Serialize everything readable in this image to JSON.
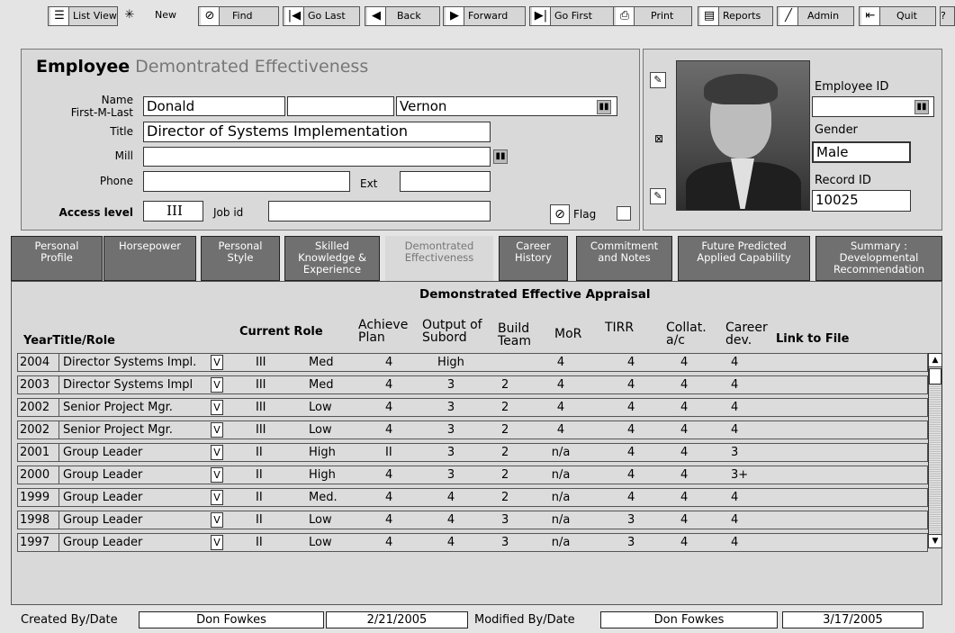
{
  "toolbar": {
    "items": [
      {
        "label": "List View",
        "icon": "list-icon"
      },
      {
        "label": "New",
        "icon": "new-icon"
      },
      {
        "label": "Find",
        "icon": "find-icon"
      },
      {
        "label": "Go Last",
        "icon": "go-last-icon"
      },
      {
        "label": "Back",
        "icon": "back-icon"
      },
      {
        "label": "Forward",
        "icon": "forward-icon"
      },
      {
        "label": "Go First",
        "icon": "go-first-icon"
      },
      {
        "label": "Print",
        "icon": "print-icon"
      },
      {
        "label": "Reports",
        "icon": "reports-icon"
      },
      {
        "label": "Admin",
        "icon": "admin-icon"
      },
      {
        "label": "Quit",
        "icon": "quit-icon"
      }
    ]
  },
  "header": {
    "title_bold": "Employee",
    "title_light": "Demontrated Effectiveness"
  },
  "form": {
    "name_label": "Name\nFirst-M-Last",
    "first_name": "Donald",
    "middle_name": "",
    "last_name": "Vernon",
    "title_label": "Title",
    "title_value": "Director of Systems Implementation",
    "mill_label": "Mill",
    "mill_value": "",
    "phone_label": "Phone",
    "phone_value": "",
    "ext_label": "Ext",
    "ext_value": "",
    "access_label": "Access level",
    "access_value": "III",
    "jobid_label": "Job id",
    "jobid_value": "",
    "flag_label": "Flag"
  },
  "side": {
    "employee_id_label": "Employee ID",
    "employee_id_value": "",
    "gender_label": "Gender",
    "gender_value": "Male",
    "record_id_label": "Record ID",
    "record_id_value": "10025"
  },
  "tabs": [
    {
      "label": "Personal\nProfile",
      "active": false
    },
    {
      "label": "Horsepower",
      "active": false
    },
    {
      "label": "Personal\nStyle",
      "active": false
    },
    {
      "label": "Skilled\nKnowledge &\nExperience",
      "active": false
    },
    {
      "label": "Demontrated\nEffectiveness",
      "active": true
    },
    {
      "label": "Career\nHistory",
      "active": false
    },
    {
      "label": "Commitment\nand Notes",
      "active": false
    },
    {
      "label": "Future Predicted\nApplied Capability",
      "active": false
    },
    {
      "label": "Summary :\nDevelopmental\nRecommendation",
      "active": false
    }
  ],
  "grid": {
    "title": "Demonstrated Effective Appraisal",
    "headers": {
      "year_title": "YearTitle/Role",
      "current_role": "Current Role",
      "achieve": "Achieve\nPlan",
      "output": "Output of\nSubord",
      "build": "Build\nTeam",
      "mor": "MoR",
      "tirr": "TIRR",
      "collat": "Collat.\na/c",
      "career": "Career\ndev.",
      "link": "Link to File"
    },
    "rows": [
      {
        "year": "2004",
        "title": "Director Systems Impl.",
        "v": "V",
        "lvl": "III",
        "role": "Med",
        "ach": "4",
        "out": "High",
        "build": "",
        "mor": "4",
        "tirr": "4",
        "col": "4",
        "car": "4"
      },
      {
        "year": "2003",
        "title": "Director Systems Impl",
        "v": "V",
        "lvl": "III",
        "role": "Med",
        "ach": "4",
        "out": "3",
        "build": "2",
        "mor": "4",
        "tirr": "4",
        "col": "4",
        "car": "4"
      },
      {
        "year": "2002",
        "title": "Senior Project Mgr.",
        "v": "V",
        "lvl": "III",
        "role": "Low",
        "ach": "4",
        "out": "3",
        "build": "2",
        "mor": "4",
        "tirr": "4",
        "col": "4",
        "car": "4"
      },
      {
        "year": "2002",
        "title": "Senior Project Mgr.",
        "v": "V",
        "lvl": "III",
        "role": "Low",
        "ach": "4",
        "out": "3",
        "build": "2",
        "mor": "4",
        "tirr": "4",
        "col": "4",
        "car": "4"
      },
      {
        "year": "2001",
        "title": "Group Leader",
        "v": "V",
        "lvl": "II",
        "role": "High",
        "ach": "II",
        "out": "3",
        "build": "2",
        "mor": "n/a",
        "tirr": "4",
        "col": "4",
        "car": "3"
      },
      {
        "year": "2000",
        "title": "Group Leader",
        "v": "V",
        "lvl": "II",
        "role": "High",
        "ach": "4",
        "out": "3",
        "build": "2",
        "mor": "n/a",
        "tirr": "4",
        "col": "4",
        "car": "3+"
      },
      {
        "year": "1999",
        "title": "Group Leader",
        "v": "V",
        "lvl": "II",
        "role": "Med.",
        "ach": "4",
        "out": "4",
        "build": "2",
        "mor": "n/a",
        "tirr": "4",
        "col": "4",
        "car": "4"
      },
      {
        "year": "1998",
        "title": "Group Leader",
        "v": "V",
        "lvl": "II",
        "role": "Low",
        "ach": "4",
        "out": "4",
        "build": "3",
        "mor": "n/a",
        "tirr": "3",
        "col": "4",
        "car": "4"
      },
      {
        "year": "1997",
        "title": "Group Leader",
        "v": "V",
        "lvl": "II",
        "role": "Low",
        "ach": "4",
        "out": "4",
        "build": "3",
        "mor": "n/a",
        "tirr": "3",
        "col": "4",
        "car": "4"
      }
    ]
  },
  "footer": {
    "created_label": "Created By/Date",
    "created_by": "Don Fowkes",
    "created_date": "2/21/2005",
    "modified_label": "Modified By/Date",
    "modified_by": "Don Fowkes",
    "modified_date": "3/17/2005"
  }
}
